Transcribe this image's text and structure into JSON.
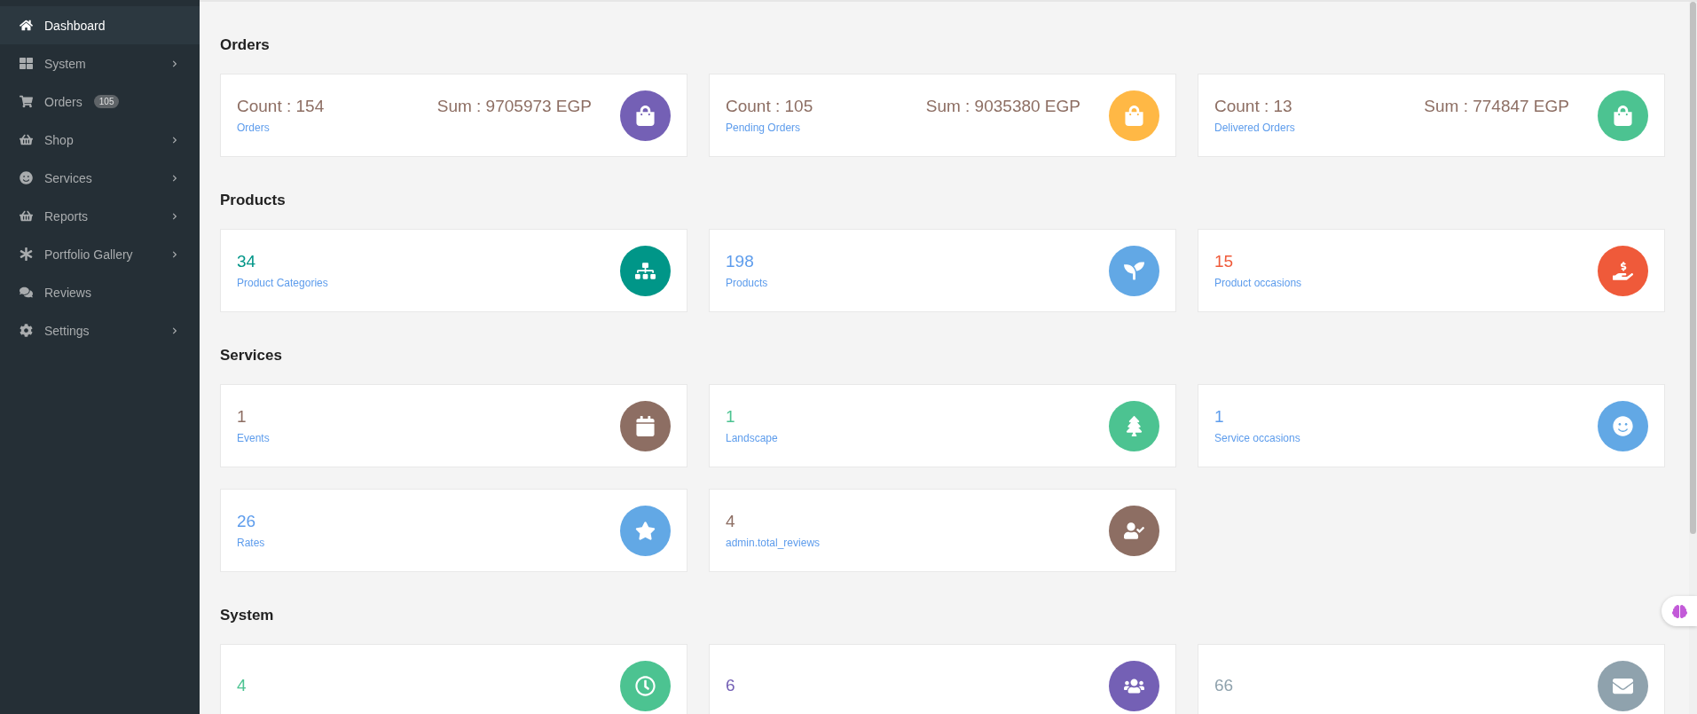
{
  "sidebar": {
    "items": [
      {
        "label": "Dashboard",
        "selected": true,
        "has_submenu": false
      },
      {
        "label": "System",
        "selected": false,
        "has_submenu": true
      },
      {
        "label": "Orders",
        "selected": false,
        "has_submenu": false,
        "badge": "105"
      },
      {
        "label": "Shop",
        "selected": false,
        "has_submenu": true
      },
      {
        "label": "Services",
        "selected": false,
        "has_submenu": true
      },
      {
        "label": "Reports",
        "selected": false,
        "has_submenu": true
      },
      {
        "label": "Portfolio Gallery",
        "selected": false,
        "has_submenu": true
      },
      {
        "label": "Reviews",
        "selected": false,
        "has_submenu": false
      },
      {
        "label": "Settings",
        "selected": false,
        "has_submenu": true
      }
    ]
  },
  "sections": [
    {
      "title": "Orders",
      "cards": [
        {
          "value": {
            "text": "Count : 154",
            "color": "#8d6e63"
          },
          "sum": "Sum : 9705973 EGP",
          "label": "Orders",
          "color": "#7460b5"
        },
        {
          "value": {
            "text": "Count : 105",
            "color": "#8d6e63"
          },
          "sum": "Sum : 9035380 EGP",
          "label": "Pending Orders",
          "color": "#ffb845"
        },
        {
          "value": {
            "text": "Count : 13",
            "color": "#8d6e63"
          },
          "sum": "Sum : 774847 EGP",
          "label": "Delivered Orders",
          "color": "#4cc391"
        }
      ]
    },
    {
      "title": "Products",
      "cards": [
        {
          "value": {
            "text": "34",
            "color": "#009688"
          },
          "label": "Product Categories",
          "color": "#009688"
        },
        {
          "value": {
            "text": "198",
            "color": "#5d9cec"
          },
          "label": "Products",
          "color": "#62a8e5"
        },
        {
          "value": {
            "text": "15",
            "color": "#ef5a3a"
          },
          "label": "Product occasions",
          "color": "#ef5a3a"
        }
      ]
    },
    {
      "title": "Services",
      "cards": [
        {
          "value": {
            "text": "1",
            "color": "#8d6e63"
          },
          "label": "Events",
          "color": "#8d6e63"
        },
        {
          "value": {
            "text": "1",
            "color": "#4cc391"
          },
          "label": "Landscape",
          "color": "#4cc391"
        },
        {
          "value": {
            "text": "1",
            "color": "#5d9cec"
          },
          "label": "Service occasions",
          "color": "#62a8e5"
        },
        {
          "value": {
            "text": "26",
            "color": "#5d9cec"
          },
          "label": "Rates",
          "color": "#62a8e5"
        },
        {
          "value": {
            "text": "4",
            "color": "#8d6e63"
          },
          "label": "admin.total_reviews",
          "color": "#8d6e63"
        }
      ]
    },
    {
      "title": "System",
      "cards": [
        {
          "value": {
            "text": "4",
            "color": "#4cc391"
          },
          "color": "#4cc391"
        },
        {
          "value": {
            "text": "6",
            "color": "#7460b5"
          },
          "color": "#7460b5"
        },
        {
          "value": {
            "text": "66",
            "color": "#8fa2ad"
          },
          "color": "#8fa2ad"
        }
      ]
    }
  ]
}
